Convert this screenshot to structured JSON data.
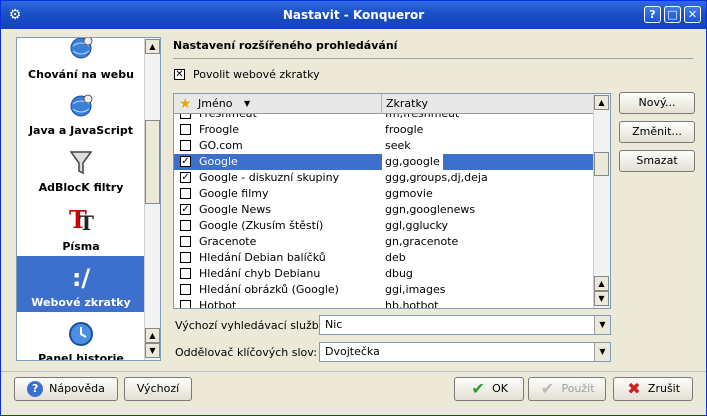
{
  "window": {
    "title": "Nastavit - Konqueror",
    "icon": "settings-app-icon"
  },
  "titlebar_buttons": [
    {
      "label": "?",
      "icon": "help-icon"
    },
    {
      "label": "□",
      "icon": "maximize-icon"
    },
    {
      "label": "✕",
      "icon": "close-icon"
    }
  ],
  "nav": {
    "items": [
      {
        "label": "Chování na webu",
        "icon": "globe-gear-icon"
      },
      {
        "label": "Java a JavaScript",
        "icon": "java-globe-icon"
      },
      {
        "label": "AdBlocK filtry",
        "icon": "funnel-icon"
      },
      {
        "label": "Písma",
        "icon": "font-icon"
      },
      {
        "label": "Webové zkratky",
        "icon": "web-shortcuts-icon"
      },
      {
        "label": "Panel historie",
        "icon": "history-icon"
      }
    ],
    "selected_label": "Webové zkratky"
  },
  "panel": {
    "title": "Nastavení rozšířeného prohledávání",
    "enable_label": "Povolit webové zkratky",
    "enable_checked": true
  },
  "list": {
    "columns": [
      "Jméno",
      "Zkratky"
    ],
    "rows": [
      {
        "name": "Freshmeat",
        "keys": "fm,freshmeat",
        "checked": false
      },
      {
        "name": "Froogle",
        "keys": "froogle",
        "checked": false
      },
      {
        "name": "GO.com",
        "keys": "seek",
        "checked": false
      },
      {
        "name": "Google",
        "keys": "gg,google",
        "checked": true,
        "selected": true
      },
      {
        "name": "Google - diskuzní skupiny",
        "keys": "ggg,groups,dj,deja",
        "checked": true
      },
      {
        "name": "Google filmy",
        "keys": "ggmovie",
        "checked": false
      },
      {
        "name": "Google News",
        "keys": "ggn,googlenews",
        "checked": true
      },
      {
        "name": "Google (Zkusím štěstí)",
        "keys": "ggl,gglucky",
        "checked": false
      },
      {
        "name": "Gracenote",
        "keys": "gn,gracenote",
        "checked": false
      },
      {
        "name": "Hledání Debian balíčků",
        "keys": "deb",
        "checked": false
      },
      {
        "name": "Hledání chyb Debianu",
        "keys": "dbug",
        "checked": false
      },
      {
        "name": "Hledání obrázků (Google)",
        "keys": "ggi,images",
        "checked": false
      },
      {
        "name": "Hotbot",
        "keys": "hb,hotbot",
        "checked": false
      }
    ]
  },
  "side_buttons": [
    "Nový...",
    "Změnit...",
    "Smazat"
  ],
  "default_engine": {
    "label": "Výchozí vyhledávací služba:",
    "value": "Nic"
  },
  "delimiter": {
    "label": "Oddělovač klíčových slov:",
    "value": "Dvojtečka"
  },
  "bottom_buttons": {
    "help": "Nápověda",
    "defaults": "Výchozí",
    "ok": "OK",
    "apply": "Použít",
    "cancel": "Zrušit"
  },
  "colors": {
    "selection": "#3d6fcc",
    "titlebar": "#1b4fc5",
    "ok_check": "#2a9d2a",
    "cancel_x": "#d02020"
  }
}
